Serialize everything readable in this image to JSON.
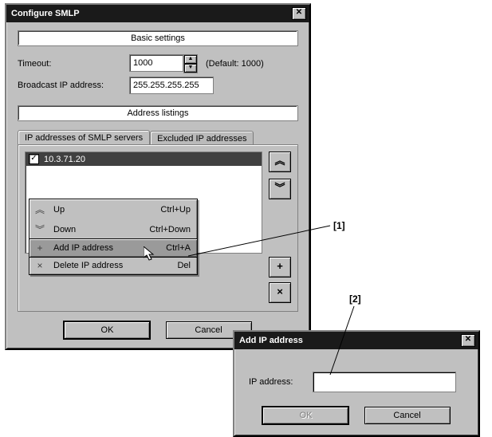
{
  "main_dialog": {
    "title": "Configure SMLP",
    "basic_header": "Basic settings",
    "timeout_label": "Timeout:",
    "timeout_value": "1000",
    "timeout_default": "(Default: 1000)",
    "broadcast_label": "Broadcast IP address:",
    "broadcast_value": "255.255.255.255",
    "address_header": "Address listings",
    "tabs": {
      "active": "IP addresses of SMLP servers",
      "inactive": "Excluded IP addresses"
    },
    "list": {
      "selected_item": "10.3.71.20",
      "checked": "✓"
    },
    "side_buttons": {
      "top": "︽",
      "down": "︾",
      "plus": "+",
      "close": "×"
    },
    "context_menu": {
      "up": {
        "label": "Up",
        "shortcut": "Ctrl+Up",
        "icon": "︽"
      },
      "down": {
        "label": "Down",
        "shortcut": "Ctrl+Down",
        "icon": "︾"
      },
      "add": {
        "label": "Add IP address",
        "shortcut": "Ctrl+A",
        "icon": "+"
      },
      "del": {
        "label": "Delete IP address",
        "shortcut": "Del",
        "icon": "×"
      }
    },
    "ok": "OK",
    "cancel": "Cancel"
  },
  "add_dialog": {
    "title": "Add IP address",
    "label": "IP address:",
    "value": "",
    "ok": "OK",
    "cancel": "Cancel"
  },
  "callouts": {
    "c1": "[1]",
    "c2": "[2]"
  }
}
